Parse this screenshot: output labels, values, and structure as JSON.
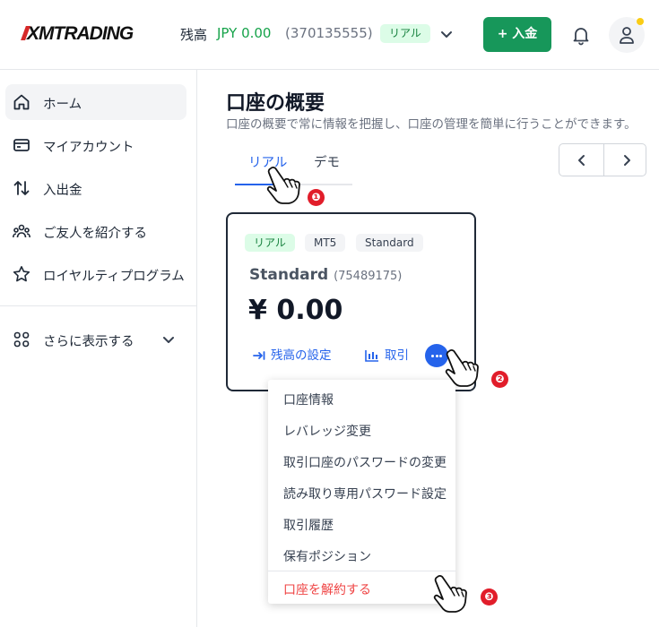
{
  "header": {
    "logo": "XMTRADING",
    "balance_label": "残高",
    "balance_amount": "JPY 0.00",
    "account_number": "(370135555)",
    "account_type": "リアル",
    "deposit_label": "+ 入金"
  },
  "sidebar": {
    "items": [
      {
        "label": "ホーム",
        "icon": "home-icon"
      },
      {
        "label": "マイアカウント",
        "icon": "card-icon"
      },
      {
        "label": "入出金",
        "icon": "transfer-arrows-icon"
      },
      {
        "label": "ご友人を紹介する",
        "icon": "people-icon"
      },
      {
        "label": "ロイヤルティプログラム",
        "icon": "star-icon"
      }
    ],
    "more_label": "さらに表示する"
  },
  "main": {
    "title": "口座の概要",
    "subtitle": "口座の概要で常に情報を把握し、口座の管理を簡単に行うことができます。",
    "tabs": [
      "リアル",
      "デモ"
    ]
  },
  "card": {
    "chips": [
      "リアル",
      "MT5",
      "Standard"
    ],
    "name": "Standard",
    "number": "(75489175)",
    "balance": "¥ 0.00",
    "set_balance_label": "残高の設定",
    "trade_label": "取引"
  },
  "menu": {
    "items": [
      "口座情報",
      "レバレッジ変更",
      "取引口座のパスワードの変更",
      "読み取り専用パスワード設定",
      "取引履歴",
      "保有ポジション"
    ],
    "close_account": "口座を解約する"
  },
  "annotations": {
    "steps": [
      "❶",
      "❷",
      "❸"
    ]
  },
  "colors": {
    "accent": "#2563eb",
    "deposit": "#17975a",
    "danger": "#ef4444",
    "step": "#e11d2a"
  }
}
